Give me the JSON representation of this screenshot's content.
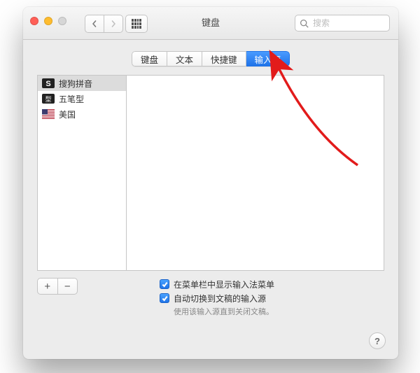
{
  "window": {
    "title": "键盘"
  },
  "search": {
    "placeholder": "搜索"
  },
  "tabs": [
    {
      "label": "键盘",
      "active": false
    },
    {
      "label": "文本",
      "active": false
    },
    {
      "label": "快捷键",
      "active": false
    },
    {
      "label": "输入源",
      "active": true
    }
  ],
  "sources": [
    {
      "label": "搜狗拼音",
      "icon": "sogou",
      "selected": true
    },
    {
      "label": "五笔型",
      "icon": "wubi",
      "selected": false
    },
    {
      "label": "美国",
      "icon": "us-flag",
      "selected": false
    }
  ],
  "buttons": {
    "add": "+",
    "remove": "−",
    "help": "?"
  },
  "options": {
    "show_in_menubar": {
      "label": "在菜单栏中显示输入法菜单",
      "checked": true
    },
    "auto_switch": {
      "label": "自动切换到文稿的输入源",
      "checked": true
    },
    "auto_switch_hint": "使用该输入源直到关闭文稿。"
  }
}
